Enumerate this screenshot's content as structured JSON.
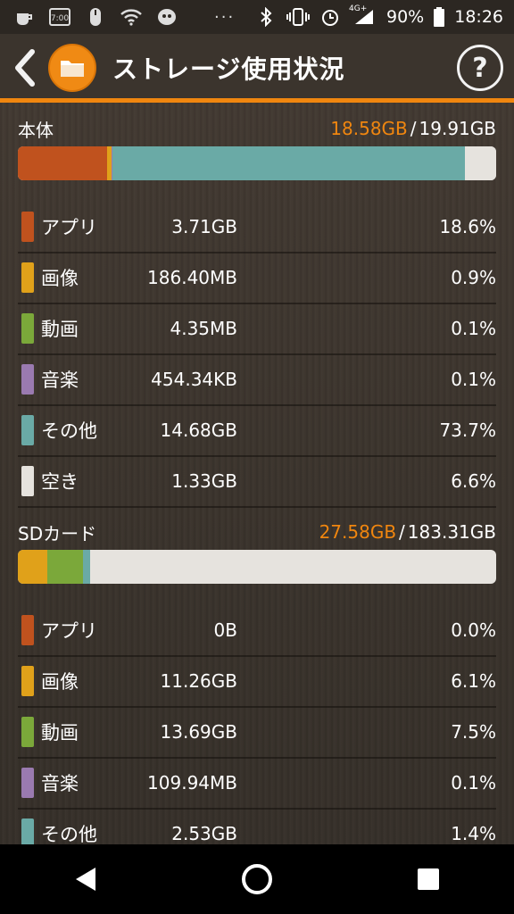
{
  "status_bar": {
    "battery": "90%",
    "time": "18:26",
    "network": "4G+",
    "dots": "···"
  },
  "header": {
    "title": "ストレージ使用状況",
    "help_label": "?"
  },
  "colors": {
    "app": "#c0521e",
    "image": "#e0a11a",
    "video": "#7ba83a",
    "music": "#9a7ab0",
    "other": "#6aaaa6",
    "free": "#e6e3de",
    "accent": "#f0860f"
  },
  "internal": {
    "name": "本体",
    "used": "18.58GB",
    "total": "19.91GB",
    "separator": "/",
    "bar_fractions": {
      "app": 0.186,
      "image": 0.009,
      "video": 0.001,
      "music": 0.001,
      "other": 0.737,
      "free": 0.066
    },
    "rows": [
      {
        "label": "アプリ",
        "size": "3.71GB",
        "pct": "18.6%",
        "key": "app"
      },
      {
        "label": "画像",
        "size": "186.40MB",
        "pct": "0.9%",
        "key": "image"
      },
      {
        "label": "動画",
        "size": "4.35MB",
        "pct": "0.1%",
        "key": "video"
      },
      {
        "label": "音楽",
        "size": "454.34KB",
        "pct": "0.1%",
        "key": "music"
      },
      {
        "label": "その他",
        "size": "14.68GB",
        "pct": "73.7%",
        "key": "other"
      },
      {
        "label": "空き",
        "size": "1.33GB",
        "pct": "6.6%",
        "key": "free"
      }
    ]
  },
  "sd": {
    "name": "SDカード",
    "used": "27.58GB",
    "total": "183.31GB",
    "separator": "/",
    "bar_fractions": {
      "app": 0.0,
      "image": 0.061,
      "video": 0.075,
      "music": 0.001,
      "other": 0.014
    },
    "rows": [
      {
        "label": "アプリ",
        "size": "0B",
        "pct": "0.0%",
        "key": "app"
      },
      {
        "label": "画像",
        "size": "11.26GB",
        "pct": "6.1%",
        "key": "image"
      },
      {
        "label": "動画",
        "size": "13.69GB",
        "pct": "7.5%",
        "key": "video"
      },
      {
        "label": "音楽",
        "size": "109.94MB",
        "pct": "0.1%",
        "key": "music"
      },
      {
        "label": "その他",
        "size": "2.53GB",
        "pct": "1.4%",
        "key": "other"
      }
    ]
  }
}
